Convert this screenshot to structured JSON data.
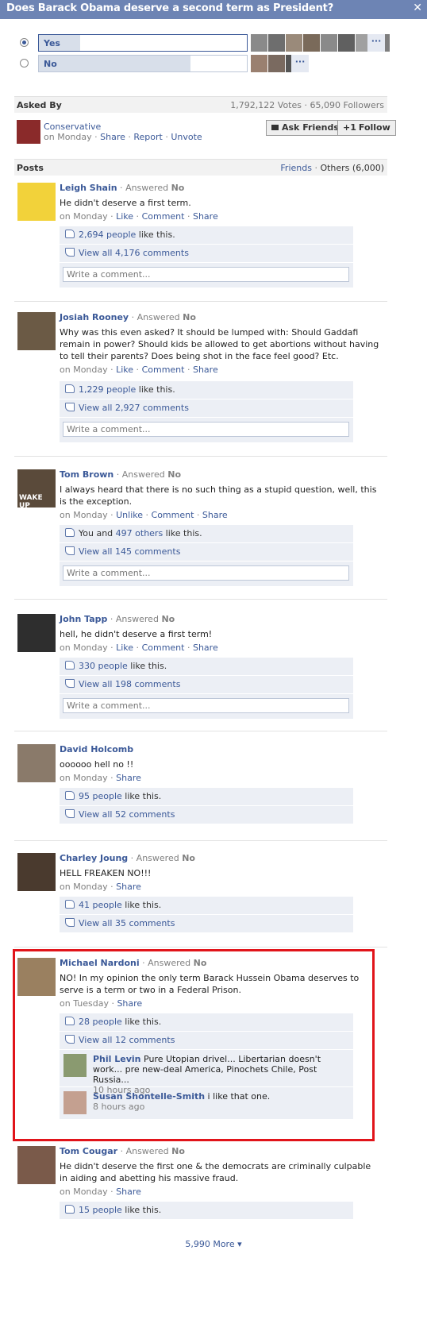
{
  "question": {
    "title": "Does Barack Obama deserve a second term as President?",
    "close": "✕"
  },
  "options": [
    {
      "label": "Yes",
      "selected": true,
      "share": 0.2
    },
    {
      "label": "No",
      "selected": false,
      "share": 0.73
    }
  ],
  "more_dots": "···",
  "asked_by": {
    "header": "Asked By",
    "stats": "1,792,122 Votes · 65,090 Followers",
    "asker": "Conservative",
    "when": "on Monday",
    "links": [
      "Share",
      "Report",
      "Unvote"
    ],
    "ask_friends": "Ask Friends",
    "follow": "Follow"
  },
  "posts_header": {
    "title": "Posts",
    "friends": "Friends",
    "others": "Others (6,000)"
  },
  "posts": [
    {
      "name": "Leigh Shain",
      "answered": "Answered",
      "answer": "No",
      "text": "He didn't deserve a first term.",
      "when": "on Monday",
      "links": [
        "Like",
        "Comment",
        "Share"
      ],
      "likes_link": "2,694 people",
      "likes_rest": " like this.",
      "comments": "View all 4,176 comments",
      "write": "Write a comment..."
    },
    {
      "name": "Josiah Rooney",
      "answered": "Answered",
      "answer": "No",
      "text": "Why was this even asked? It should be lumped with: Should Gaddafi remain in power? Should kids be allowed to get abortions without having to tell their parents? Does being shot in the face feel good? Etc.",
      "when": "on Monday",
      "links": [
        "Like",
        "Comment",
        "Share"
      ],
      "likes_link": "1,229 people",
      "likes_rest": " like this.",
      "comments": "View all 2,927 comments",
      "write": "Write a comment..."
    },
    {
      "name": "Tom Brown",
      "answered": "Answered",
      "answer": "No",
      "text": "I always heard that there is no such thing as a stupid question, well, this is the exception.",
      "when": "on Monday",
      "links": [
        "Unlike",
        "Comment",
        "Share"
      ],
      "likes_pre": "You and ",
      "likes_link": "497 others",
      "likes_rest": " like this.",
      "comments": "View all 145 comments",
      "write": "Write a comment...",
      "avatar_text": "WAKE UP"
    },
    {
      "name": "John Tapp",
      "answered": "Answered",
      "answer": "No",
      "text": "hell, he didn't deserve a first term!",
      "when": "on Monday",
      "links": [
        "Like",
        "Comment",
        "Share"
      ],
      "likes_link": "330 people",
      "likes_rest": " like this.",
      "comments": "View all 198 comments",
      "write": "Write a comment..."
    },
    {
      "name": "David Holcomb",
      "text": "oooooo hell no !!",
      "when": "on Monday",
      "links": [
        "Share"
      ],
      "likes_link": "95 people",
      "likes_rest": " like this.",
      "comments": "View all 52 comments"
    },
    {
      "name": "Charley Joung",
      "answered": "Answered",
      "answer": "No",
      "text": "HELL FREAKEN NO!!!",
      "when": "on Monday",
      "links": [
        "Share"
      ],
      "likes_link": "41 people",
      "likes_rest": " like this.",
      "comments": "View all 35 comments"
    },
    {
      "name": "Michael Nardoni",
      "answered": "Answered",
      "answer": "No",
      "text": "NO! In my opinion the only term Barack Hussein Obama deserves to serve is a term or two in a Federal Prison.",
      "when": "on Tuesday",
      "links": [
        "Share"
      ],
      "likes_link": "28 people",
      "likes_rest": " like this.",
      "comments": "View all 12 comments",
      "replies": [
        {
          "name": "Phil Levin",
          "text": " Pure Utopian drivel... Libertarian doesn't work... pre new-deal America, Pinochets Chile, Post Russia...",
          "ago": "10 hours ago"
        },
        {
          "name": "Susan Shontelle-Smith",
          "text": " i like that one.",
          "ago": "8 hours ago"
        }
      ]
    },
    {
      "name": "Tom Cougar",
      "answered": "Answered",
      "answer": "No",
      "text": "He didn't deserve the first one & the democrats are criminally culpable in aiding and abetting his massive fraud.",
      "when": "on Monday",
      "links": [
        "Share"
      ],
      "likes_link": "15 people",
      "likes_rest": " like this."
    }
  ],
  "more": "5,990 More"
}
